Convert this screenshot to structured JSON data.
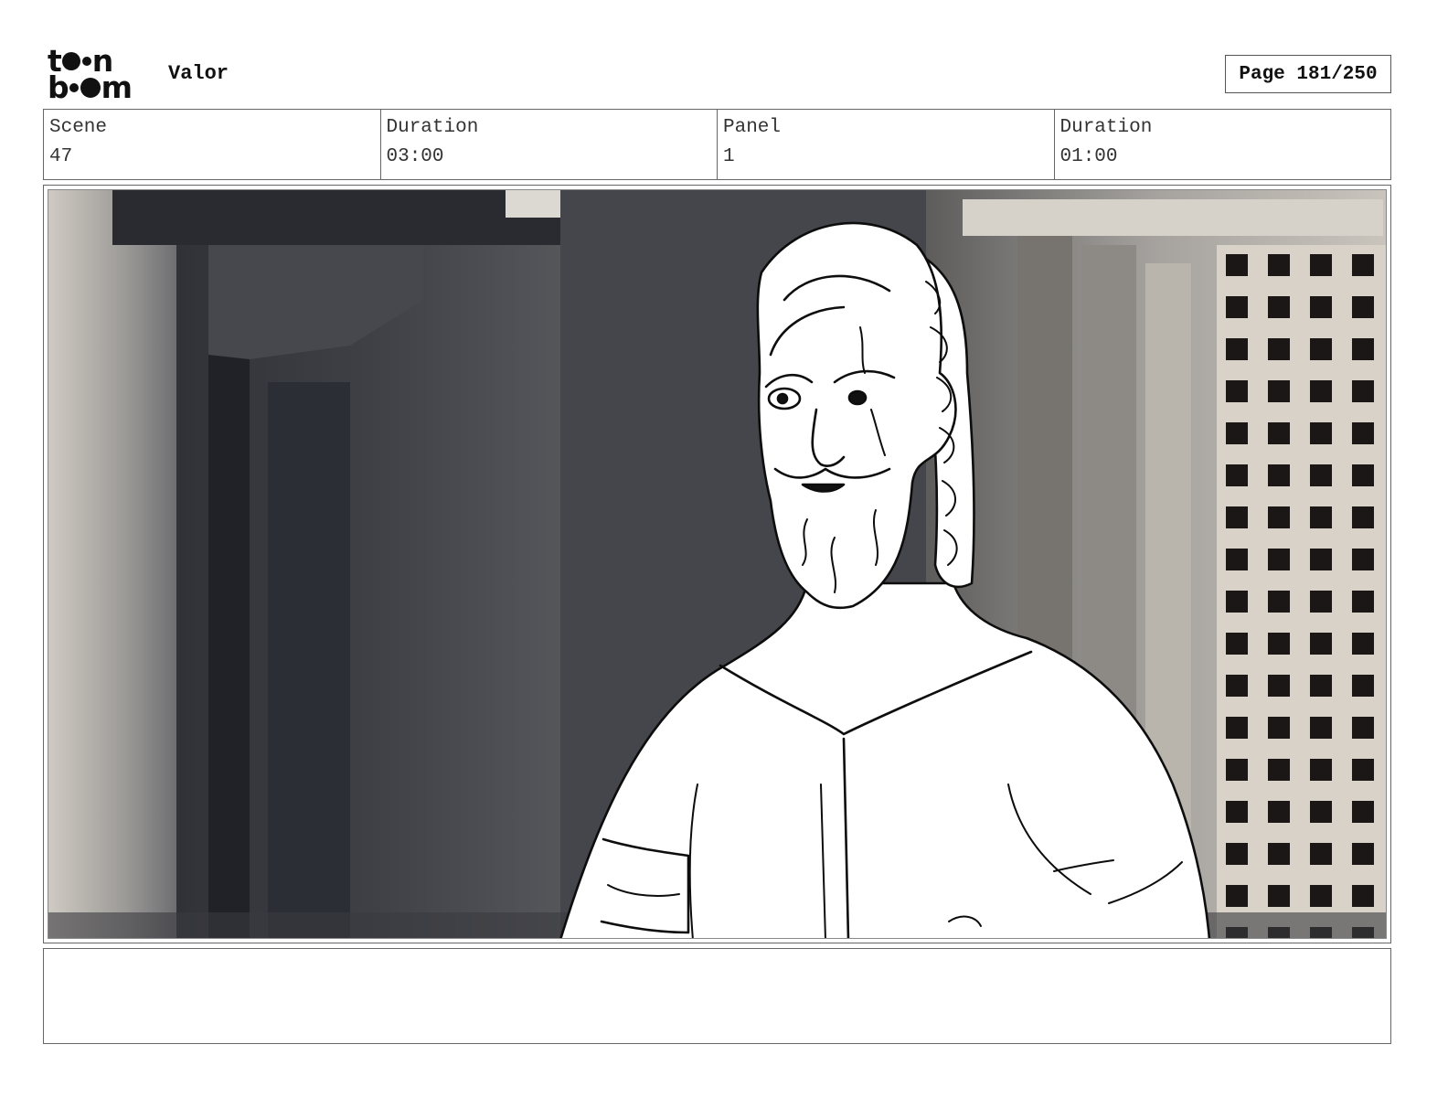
{
  "header": {
    "logo_top": "t",
    "logo_top_end": "n",
    "logo_bottom_start": "b",
    "logo_bottom_end": "m",
    "project_title": "Valor",
    "page_label": "Page 181/250"
  },
  "info": {
    "scene_label": "Scene",
    "scene_value": "47",
    "scene_duration_label": "Duration",
    "scene_duration_value": "03:00",
    "panel_label": "Panel",
    "panel_value": "1",
    "panel_duration_label": "Duration",
    "panel_duration_value": "01:00"
  },
  "notes": {
    "text": ""
  }
}
